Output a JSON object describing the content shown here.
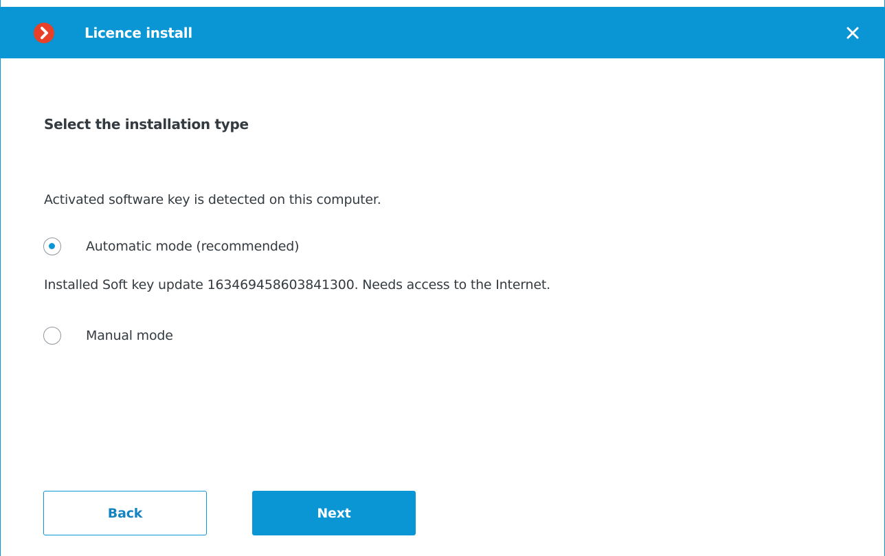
{
  "window": {
    "title": "Licence install",
    "logo_icon": "chevron-right-logo-icon",
    "close_icon": "close-icon",
    "accent_color": "#0a96d4",
    "logo_color": "#e8412a"
  },
  "content": {
    "heading": "Select the installation type",
    "detected_message": "Activated software key is detected on this computer.",
    "options": [
      {
        "label": "Automatic mode (recommended)",
        "selected": true
      },
      {
        "label": "Manual mode",
        "selected": false
      }
    ],
    "automatic_description": "Installed Soft key update 163469458603841300. Needs access to the Internet."
  },
  "footer": {
    "back_label": "Back",
    "next_label": "Next"
  }
}
